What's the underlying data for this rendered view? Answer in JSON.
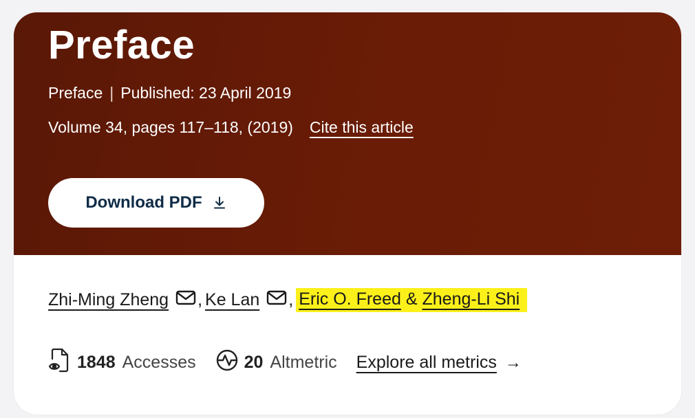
{
  "article": {
    "title": "Preface",
    "type": "Preface",
    "separator": "|",
    "published": "Published: 23 April 2019",
    "volume_info": "Volume 34, pages 117–118, (2019)",
    "cite_label": "Cite this article"
  },
  "download": {
    "label": "Download PDF",
    "icon": "download-icon"
  },
  "authors": [
    {
      "name": "Zhi-Ming Zheng",
      "has_mail": true,
      "highlighted": false,
      "suffix": ","
    },
    {
      "name": "Ke Lan",
      "has_mail": true,
      "highlighted": false,
      "suffix": ","
    },
    {
      "name": "Eric O. Freed",
      "has_mail": false,
      "highlighted": true,
      "suffix": "&"
    },
    {
      "name": "Zheng-Li Shi",
      "has_mail": false,
      "highlighted": true,
      "suffix": ""
    }
  ],
  "metrics": {
    "accesses_count": "1848",
    "accesses_label": "Accesses",
    "altmetric_count": "20",
    "altmetric_label": "Altmetric",
    "explore_label": "Explore all metrics",
    "explore_arrow": "→"
  },
  "colors": {
    "hero_bg": "#6a1c06",
    "button_text": "#0f2c47",
    "highlight": "#fbf01a"
  }
}
